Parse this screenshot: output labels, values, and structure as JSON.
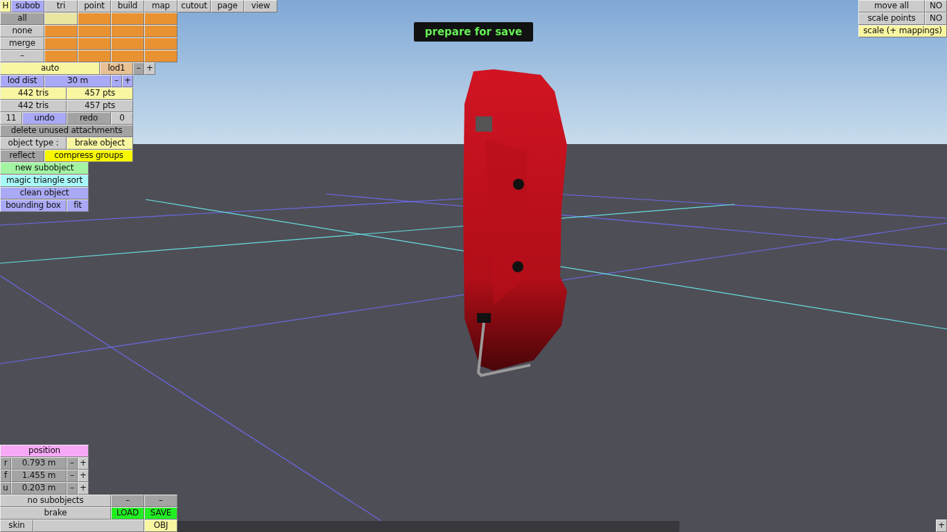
{
  "help_button": "H",
  "tabs": [
    {
      "label": "subob",
      "selected": true
    },
    {
      "label": "tri",
      "selected": false
    },
    {
      "label": "point",
      "selected": false
    },
    {
      "label": "build",
      "selected": false
    },
    {
      "label": "map",
      "selected": false
    },
    {
      "label": "cutout",
      "selected": false
    },
    {
      "label": "page",
      "selected": false
    },
    {
      "label": "view",
      "selected": false
    }
  ],
  "selection_buttons": [
    {
      "label": "all",
      "selected": true
    },
    {
      "label": "none",
      "selected": false
    },
    {
      "label": "merge",
      "selected": false
    },
    {
      "label": "–",
      "selected": false
    }
  ],
  "swatches": [
    {
      "selected": true
    },
    {
      "selected": false
    },
    {
      "selected": false
    },
    {
      "selected": false
    },
    {
      "selected": false
    },
    {
      "selected": false
    },
    {
      "selected": false
    },
    {
      "selected": false
    },
    {
      "selected": false
    },
    {
      "selected": false
    },
    {
      "selected": false
    },
    {
      "selected": false
    },
    {
      "selected": false
    },
    {
      "selected": false
    },
    {
      "selected": false
    },
    {
      "selected": false
    }
  ],
  "lod": {
    "mode": "auto",
    "name": "lod1",
    "minus": "–",
    "plus": "+"
  },
  "lod_dist": {
    "label": "lod dist",
    "value": "30 m",
    "minus": "–",
    "plus": "+"
  },
  "counts": [
    {
      "tris": "442 tris",
      "pts": "457 pts"
    },
    {
      "tris": "442 tris",
      "pts": "457 pts"
    }
  ],
  "history": {
    "undo_count": "11",
    "undo": "undo",
    "redo": "redo",
    "redo_count": "0"
  },
  "delete_button": "delete unused attachments",
  "object_type": {
    "label": "object type :",
    "value": "brake object"
  },
  "reflect_button": "reflect",
  "compress_button": "compress groups",
  "actions": [
    {
      "kind": "new",
      "label": "new subobject"
    },
    {
      "kind": "sort",
      "label": "magic triangle sort"
    },
    {
      "kind": "clean",
      "label": "clean object"
    }
  ],
  "bounding": {
    "label": "bounding box",
    "fit": "fit"
  },
  "banner": "prepare for save",
  "right_options": [
    {
      "label": "move all",
      "value": "NO"
    },
    {
      "label": "scale points",
      "value": "NO"
    }
  ],
  "scale_mappings": "scale (+ mappings)",
  "position": {
    "title": "position",
    "axes": [
      {
        "axis": "r",
        "value": "0.793 m",
        "minus": "–",
        "plus": "+"
      },
      {
        "axis": "f",
        "value": "1.455 m",
        "minus": "–",
        "plus": "+"
      },
      {
        "axis": "u",
        "value": "0.203 m",
        "minus": "–",
        "plus": "+"
      }
    ]
  },
  "file": {
    "subobjects": "no subobjects",
    "sub_buttons": [
      "–",
      "–"
    ],
    "name": "brake",
    "load": "LOAD",
    "save": "SAVE",
    "skin": "skin",
    "obj": "OBJ"
  },
  "corner_plus": "+"
}
